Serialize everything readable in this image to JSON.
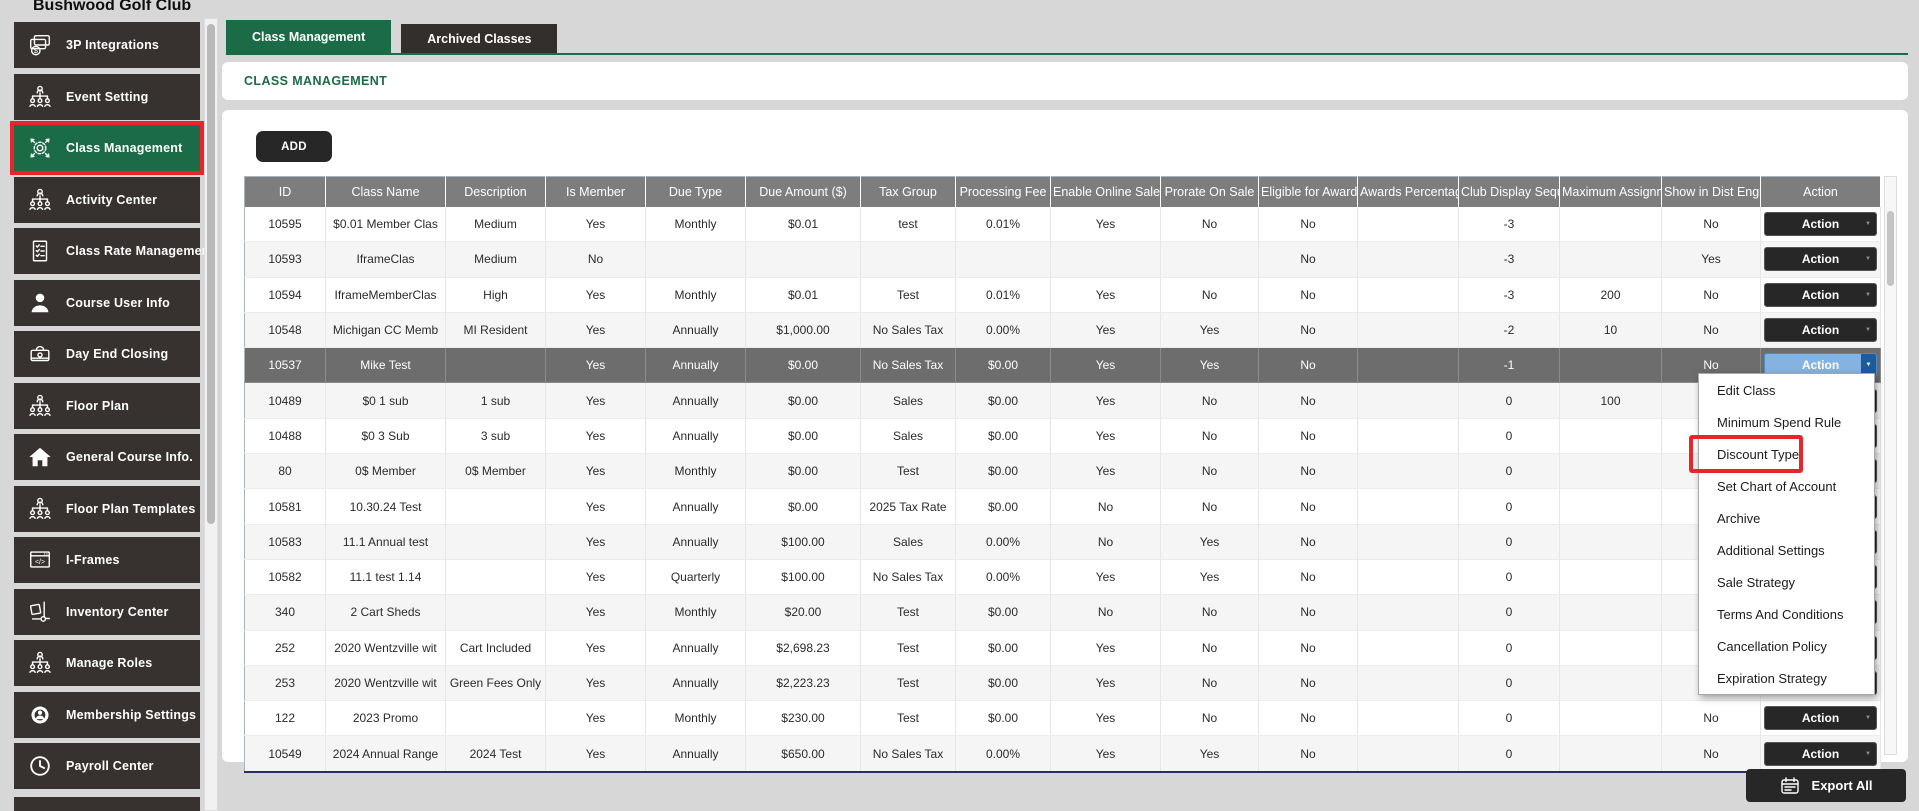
{
  "app": {
    "title": "Bushwood Golf Club"
  },
  "colors": {
    "accent_green": "#1b6b47",
    "annotation_red": "#e8252b",
    "sidebar_dark": "#37322f",
    "header_gray": "#7d7d7d",
    "selected_row_gray": "#6d6d6d",
    "action_open_blue": "#85b3e0",
    "action_open_blue_dark": "#1d5c99"
  },
  "sidebar": {
    "items": [
      {
        "label": "3P Integrations",
        "icon": "cards-dollar-icon",
        "active": false
      },
      {
        "label": "Event Setting",
        "icon": "org-chart-icon",
        "active": false
      },
      {
        "label": "Class Management",
        "icon": "gear-arrows-icon",
        "active": true,
        "annotated": true
      },
      {
        "label": "Activity Center",
        "icon": "org-chart-icon",
        "active": false
      },
      {
        "label": "Class Rate Management",
        "icon": "doc-checklist-icon",
        "active": false
      },
      {
        "label": "Course User Info",
        "icon": "person-icon",
        "active": false
      },
      {
        "label": "Day End Closing",
        "icon": "cash-drawer-icon",
        "active": false
      },
      {
        "label": "Floor Plan",
        "icon": "org-chart-icon",
        "active": false
      },
      {
        "label": "General Course Info.",
        "icon": "home-icon",
        "active": false
      },
      {
        "label": "Floor Plan Templates",
        "icon": "org-chart-icon",
        "active": false
      },
      {
        "label": "I-Frames",
        "icon": "code-window-icon",
        "active": false
      },
      {
        "label": "Inventory Center",
        "icon": "handtruck-icon",
        "active": false
      },
      {
        "label": "Manage Roles",
        "icon": "org-chart-icon",
        "active": false
      },
      {
        "label": "Membership Settings",
        "icon": "gear-person-icon",
        "active": false
      },
      {
        "label": "Payroll Center",
        "icon": "clock-icon",
        "active": false
      }
    ]
  },
  "tabs": [
    {
      "label": "Class Management",
      "active": true
    },
    {
      "label": "Archived Classes",
      "active": false
    }
  ],
  "section_title": "CLASS MANAGEMENT",
  "toolbar": {
    "add_label": "ADD",
    "export_label": "Export All"
  },
  "table": {
    "columns": [
      "ID",
      "Class Name",
      "Description",
      "Is Member",
      "Due Type",
      "Due Amount ($)",
      "Tax Group",
      "Processing Fee",
      "Enable Online Sale",
      "Prorate On Sale",
      "Eligible for Awards",
      "Awards Percentage",
      "Club Display Seque",
      "Maximum Assignm",
      "Show in Dist Engin",
      "Action"
    ],
    "action_label": "Action",
    "rows": [
      {
        "selected": false,
        "cells": [
          "10595",
          "$0.01 Member Clas",
          "Medium",
          "Yes",
          "Monthly",
          "$0.01",
          "test",
          "0.01%",
          "Yes",
          "No",
          "No",
          "",
          "-3",
          "",
          "No"
        ]
      },
      {
        "selected": false,
        "cells": [
          "10593",
          "IframeClas",
          "Medium",
          "No",
          "",
          "",
          "",
          "",
          "",
          "",
          "No",
          "",
          "-3",
          "",
          "Yes"
        ]
      },
      {
        "selected": false,
        "cells": [
          "10594",
          "IframeMemberClas",
          "High",
          "Yes",
          "Monthly",
          "$0.01",
          "Test",
          "0.01%",
          "Yes",
          "No",
          "No",
          "",
          "-3",
          "200",
          "No"
        ]
      },
      {
        "selected": false,
        "cells": [
          "10548",
          "Michigan CC Memb",
          "MI Resident",
          "Yes",
          "Annually",
          "$1,000.00",
          "No Sales Tax",
          "0.00%",
          "Yes",
          "Yes",
          "No",
          "",
          "-2",
          "10",
          "No"
        ]
      },
      {
        "selected": true,
        "cells": [
          "10537",
          "Mike Test",
          "",
          "Yes",
          "Annually",
          "$0.00",
          "No Sales Tax",
          "$0.00",
          "Yes",
          "Yes",
          "No",
          "",
          "-1",
          "",
          "No"
        ]
      },
      {
        "selected": false,
        "cells": [
          "10489",
          "$0 1 sub",
          "1 sub",
          "Yes",
          "Annually",
          "$0.00",
          "Sales",
          "$0.00",
          "Yes",
          "No",
          "No",
          "",
          "0",
          "100",
          ""
        ]
      },
      {
        "selected": false,
        "cells": [
          "10488",
          "$0 3 Sub",
          "3 sub",
          "Yes",
          "Annually",
          "$0.00",
          "Sales",
          "$0.00",
          "Yes",
          "No",
          "No",
          "",
          "0",
          "",
          ""
        ]
      },
      {
        "selected": false,
        "cells": [
          "80",
          "0$ Member",
          "0$ Member",
          "Yes",
          "Monthly",
          "$0.00",
          "Test",
          "$0.00",
          "Yes",
          "No",
          "No",
          "",
          "0",
          "",
          ""
        ]
      },
      {
        "selected": false,
        "cells": [
          "10581",
          "10.30.24 Test",
          "",
          "Yes",
          "Annually",
          "$0.00",
          "2025 Tax Rate",
          "$0.00",
          "No",
          "No",
          "No",
          "",
          "0",
          "",
          ""
        ]
      },
      {
        "selected": false,
        "cells": [
          "10583",
          "11.1 Annual test",
          "",
          "Yes",
          "Annually",
          "$100.00",
          "Sales",
          "0.00%",
          "No",
          "Yes",
          "No",
          "",
          "0",
          "",
          ""
        ]
      },
      {
        "selected": false,
        "cells": [
          "10582",
          "11.1 test 1.14",
          "",
          "Yes",
          "Quarterly",
          "$100.00",
          "No Sales Tax",
          "0.00%",
          "Yes",
          "Yes",
          "No",
          "",
          "0",
          "",
          ""
        ]
      },
      {
        "selected": false,
        "cells": [
          "340",
          "2 Cart Sheds",
          "",
          "Yes",
          "Monthly",
          "$20.00",
          "Test",
          "$0.00",
          "No",
          "No",
          "No",
          "",
          "0",
          "",
          ""
        ]
      },
      {
        "selected": false,
        "cells": [
          "252",
          "2020 Wentzville wit",
          "Cart Included",
          "Yes",
          "Annually",
          "$2,698.23",
          "Test",
          "$0.00",
          "Yes",
          "No",
          "No",
          "",
          "0",
          "",
          ""
        ]
      },
      {
        "selected": false,
        "cells": [
          "253",
          "2020 Wentzville wit",
          "Green Fees Only",
          "Yes",
          "Annually",
          "$2,223.23",
          "Test",
          "$0.00",
          "Yes",
          "No",
          "No",
          "",
          "0",
          "",
          ""
        ]
      },
      {
        "selected": false,
        "cells": [
          "122",
          "2023 Promo",
          "",
          "Yes",
          "Monthly",
          "$230.00",
          "Test",
          "$0.00",
          "Yes",
          "No",
          "No",
          "",
          "0",
          "",
          "No"
        ]
      },
      {
        "selected": false,
        "cells": [
          "10549",
          "2024 Annual Range",
          "2024 Test",
          "Yes",
          "Annually",
          "$650.00",
          "No Sales Tax",
          "0.00%",
          "Yes",
          "Yes",
          "No",
          "",
          "0",
          "",
          "No"
        ]
      }
    ]
  },
  "action_menu": {
    "items": [
      "Edit Class",
      "Minimum Spend Rule",
      "Discount Type",
      "Set Chart of Account",
      "Archive",
      "Additional Settings",
      "Sale Strategy",
      "Terms And Conditions",
      "Cancellation Policy",
      "Expiration Strategy"
    ],
    "highlighted": "Discount Type"
  }
}
